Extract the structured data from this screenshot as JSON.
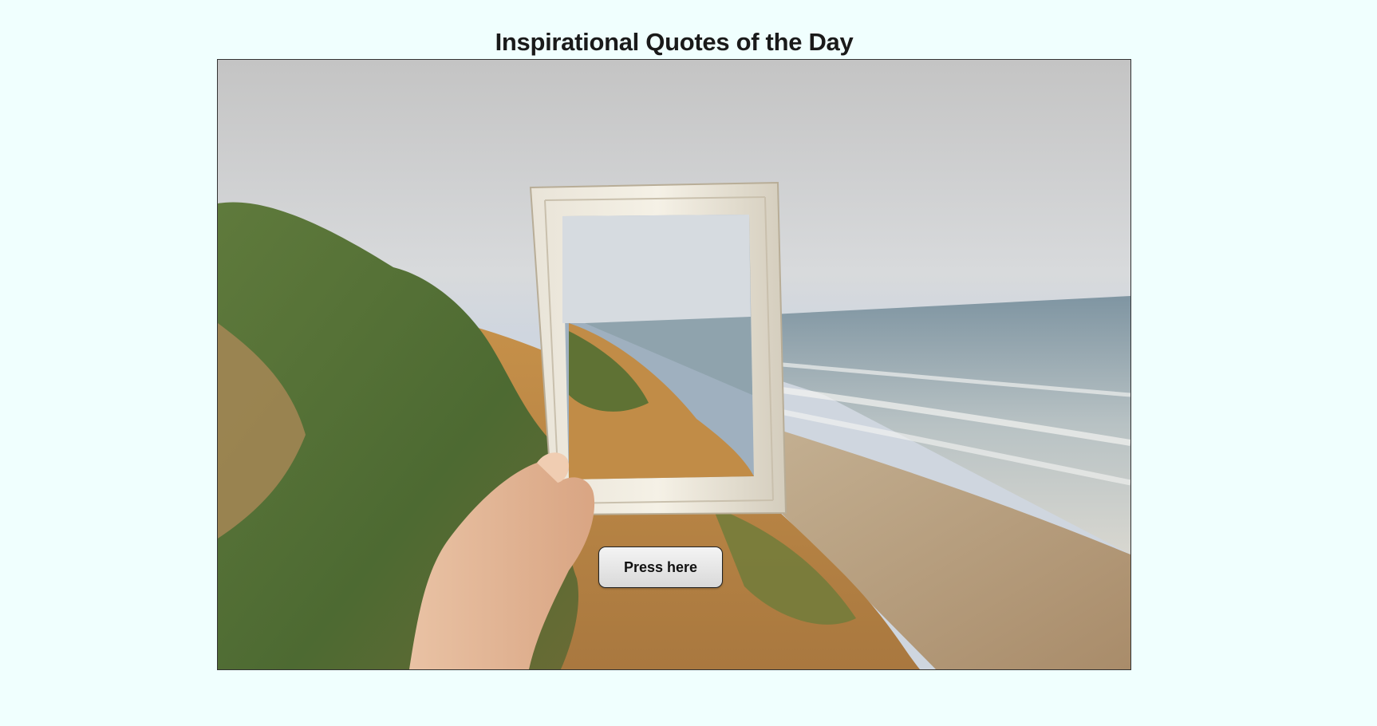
{
  "page": {
    "title": "Inspirational Quotes of the Day"
  },
  "image": {
    "subject": "hand-holding-frame-over-coastal-cliff-photo"
  },
  "button": {
    "label": "Press here"
  },
  "colors": {
    "background": "#f0fffe",
    "button_bg": "#e6e6e6",
    "title_text": "#1a1a1a"
  }
}
